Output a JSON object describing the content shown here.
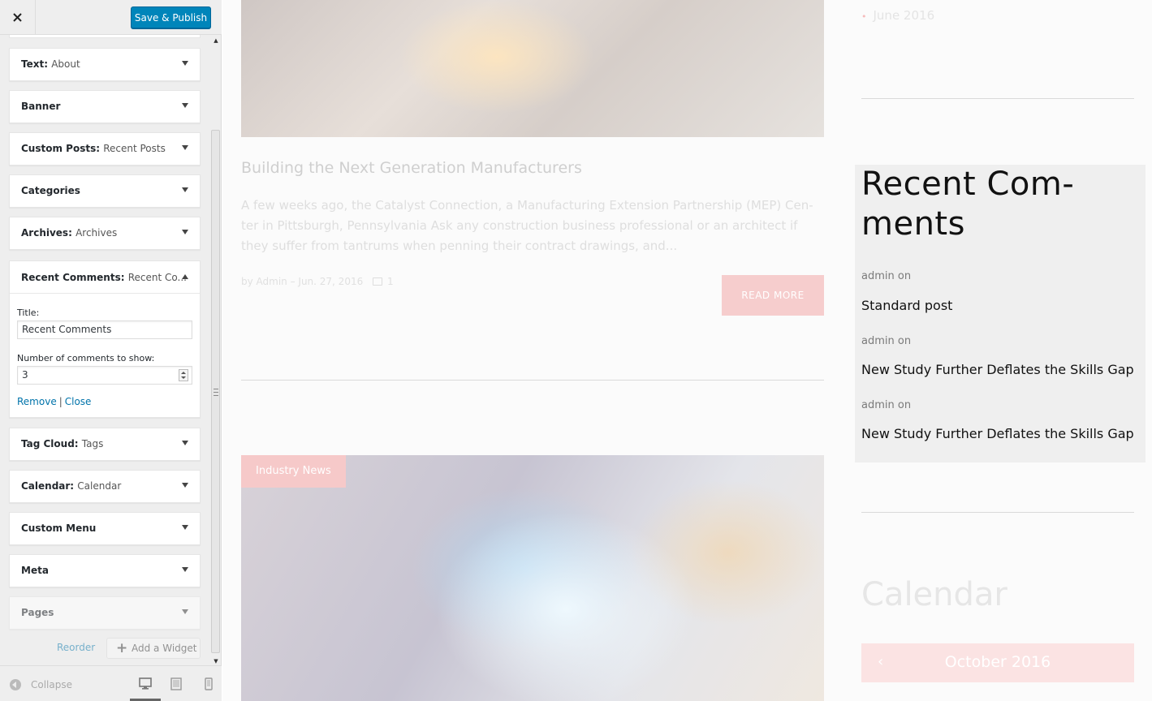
{
  "toolbar": {
    "close_icon": "close-icon",
    "save_label": "Save & Publish"
  },
  "widgets": [
    {
      "type": "Text:",
      "title": "About"
    },
    {
      "type": "Banner",
      "title": ""
    },
    {
      "type": "Custom Posts:",
      "title": "Recent Posts"
    },
    {
      "type": "Categories",
      "title": ""
    },
    {
      "type": "Archives:",
      "title": "Archives"
    },
    {
      "type": "Tag Cloud:",
      "title": "Tags"
    },
    {
      "type": "Calendar:",
      "title": "Calendar"
    },
    {
      "type": "Custom Menu",
      "title": ""
    },
    {
      "type": "Meta",
      "title": ""
    },
    {
      "type": "Pages",
      "title": ""
    }
  ],
  "open_widget": {
    "type": "Recent Comments:",
    "title": "Recent Co...",
    "title_label": "Title:",
    "title_value": "Recent Comments",
    "count_label": "Number of comments to show:",
    "count_value": "3",
    "remove_label": "Remove",
    "separator": "|",
    "close_label": "Close"
  },
  "actions": {
    "reorder_label": "Reorder",
    "add_widget_label": "Add a Widget"
  },
  "footer": {
    "collapse_label": "Collapse",
    "devices": [
      "desktop-icon",
      "tablet-icon",
      "mobile-icon"
    ],
    "active_device": "desktop"
  },
  "preview": {
    "archive_item": "June 2016",
    "post": {
      "title": "Building the Next Generation Manufacturers",
      "excerpt": "A few weeks ago, the Catalyst Connection, a Manufacturing Extension Partnership (MEP) Cen-ter in Pittsburgh, Pennsylvania Ask any construction business professional or an architect if they suffer from tantrums when penning their contract drawings, and...",
      "meta": "by Admin – Jun. 27, 2016",
      "comment_count": "1",
      "read_more": "READ MORE"
    },
    "category_tag": "Industry News",
    "recent_comments": {
      "title": "Recent Com-ments",
      "items": [
        {
          "author": "admin on",
          "post": "Standard post"
        },
        {
          "author": "admin on",
          "post": "New Study Further Deflates the Skills Gap"
        },
        {
          "author": "admin on",
          "post": "New Study Further Deflates the Skills Gap"
        }
      ]
    },
    "calendar": {
      "title": "Calendar",
      "month": "October 2016"
    }
  },
  "colors": {
    "accent": "#0085ba",
    "link": "#0073aa",
    "pink": "#f6cdcd",
    "highlight": "#efefef"
  }
}
